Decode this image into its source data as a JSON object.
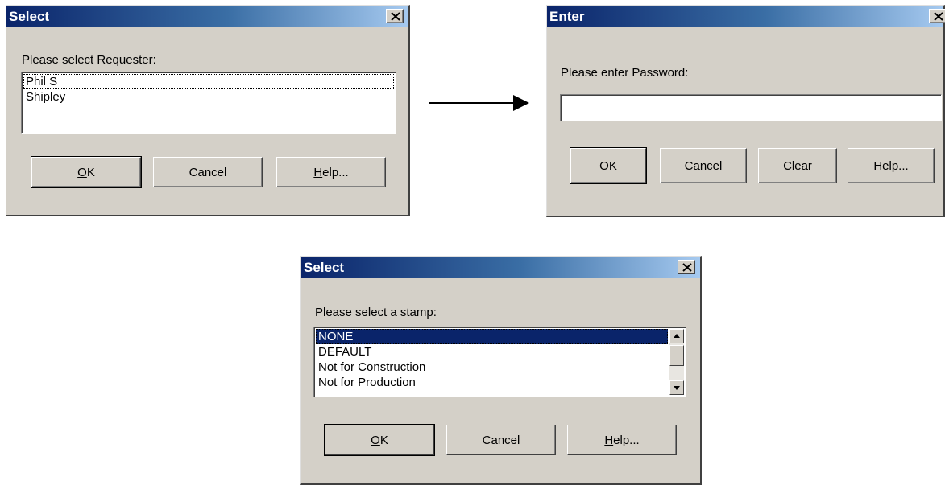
{
  "dialog_requester": {
    "title": "Select",
    "prompt": "Please select Requester:",
    "items": [
      "Phil S",
      "Shipley"
    ],
    "buttons": {
      "ok_mnemonic": "O",
      "ok_rest": "K",
      "cancel": "Cancel",
      "help_mnemonic": "H",
      "help_rest": "elp..."
    }
  },
  "dialog_password": {
    "title": "Enter",
    "prompt": "Please enter Password:",
    "password_value": "",
    "buttons": {
      "ok_mnemonic": "O",
      "ok_rest": "K",
      "cancel": "Cancel",
      "clear_mnemonic": "C",
      "clear_rest": "lear",
      "help_mnemonic": "H",
      "help_rest": "elp..."
    }
  },
  "dialog_stamp": {
    "title": "Select",
    "prompt": "Please select a stamp:",
    "items": [
      "NONE",
      "DEFAULT",
      "Not for Construction",
      "Not for Production"
    ],
    "selected_item": "NONE",
    "buttons": {
      "ok_mnemonic": "O",
      "ok_rest": "K",
      "cancel": "Cancel",
      "help_mnemonic": "H",
      "help_rest": "elp..."
    }
  },
  "icons": {
    "close": "close-x-icon",
    "flow": "arrow-right-icon",
    "scroll_up": "scroll-up-arrow-icon",
    "scroll_down": "scroll-down-arrow-icon"
  },
  "colors": {
    "titlebar_start": "#0a246a",
    "titlebar_end": "#a6caf0",
    "dialog_face": "#d4d0c8",
    "selection": "#0a246a"
  }
}
